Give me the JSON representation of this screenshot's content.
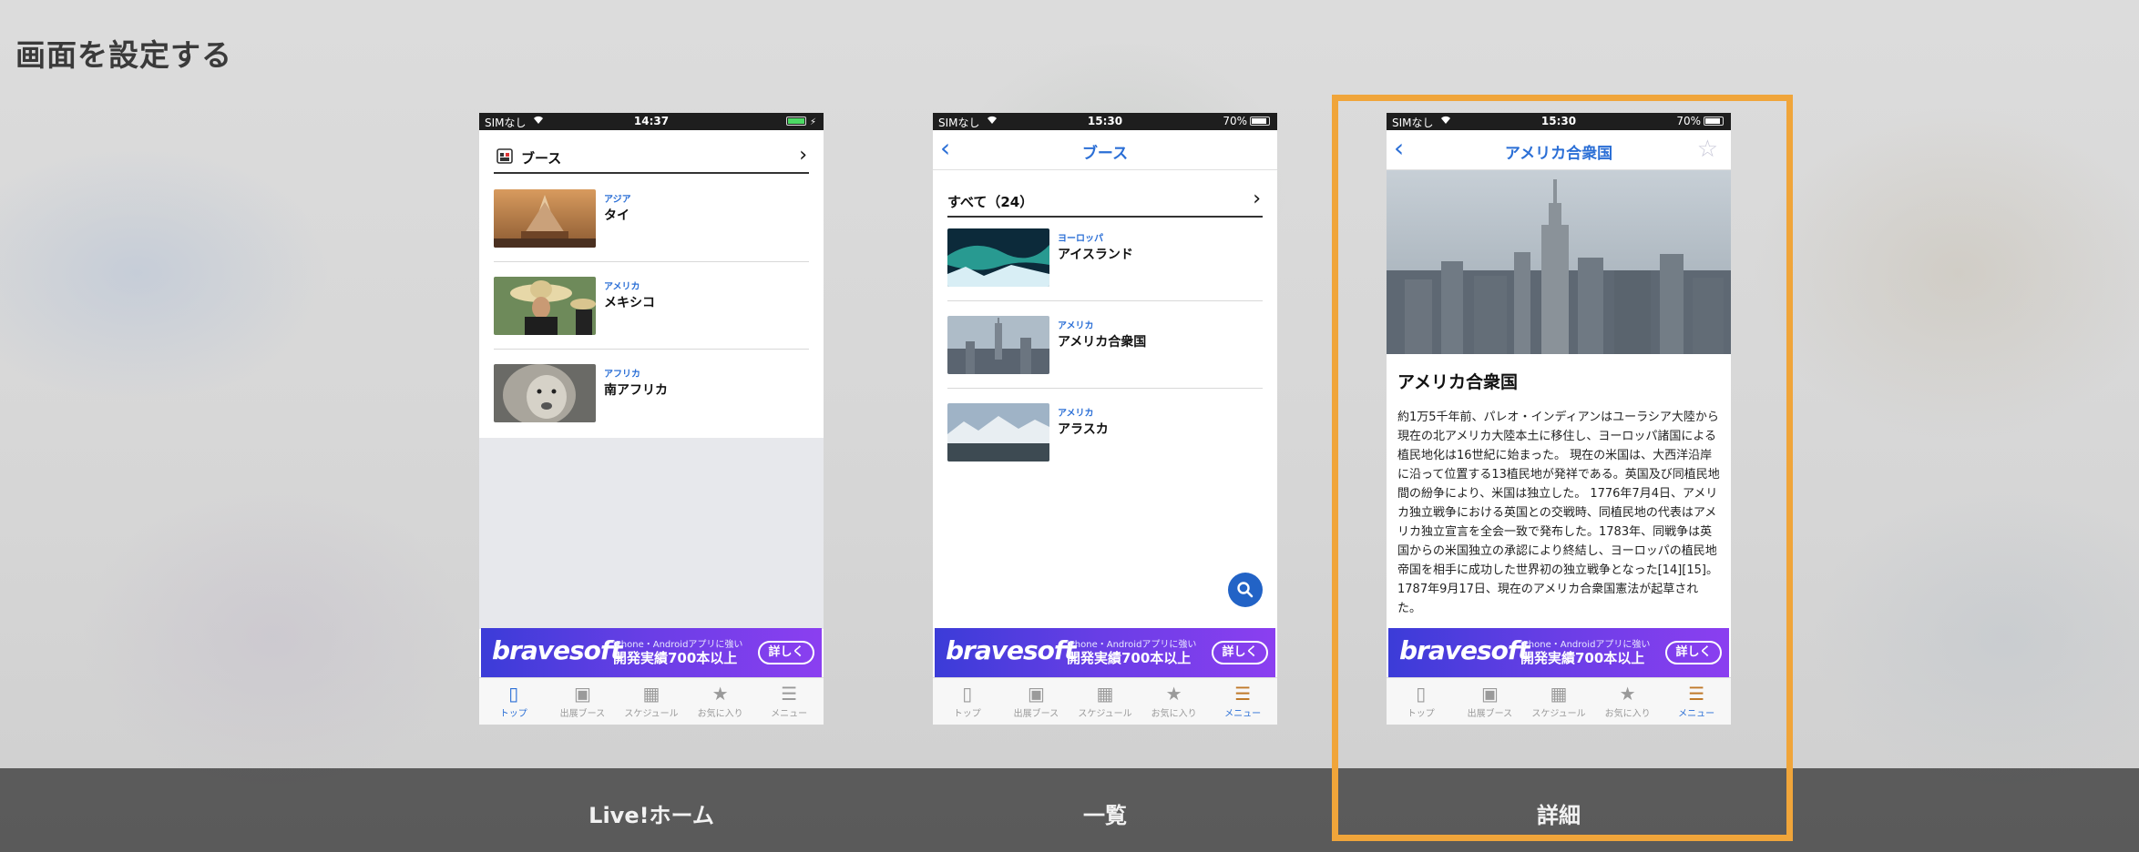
{
  "page": {
    "title": "画面を設定する"
  },
  "captions": [
    "Live!ホーム",
    "一覧",
    "詳細"
  ],
  "colors": {
    "accent": "#2b6fd6",
    "highlight": "#f0a53a",
    "ad_start": "#3b3cd8",
    "ad_end": "#8b3ff0"
  },
  "phone1": {
    "status": {
      "carrier": "SIMなし",
      "time": "14:37"
    },
    "section": {
      "label": "ブース"
    },
    "items": [
      {
        "region": "アジア",
        "name": "タイ",
        "image": "thai-temple"
      },
      {
        "region": "アメリカ",
        "name": "メキシコ",
        "image": "mariachi"
      },
      {
        "region": "アフリカ",
        "name": "南アフリカ",
        "image": "lion"
      }
    ]
  },
  "phone2": {
    "status": {
      "carrier": "SIMなし",
      "time": "15:30",
      "battery": "70%"
    },
    "nav": {
      "title": "ブース"
    },
    "section": {
      "label": "すべて（24）"
    },
    "items": [
      {
        "region": "ヨーロッパ",
        "name": "アイスランド",
        "image": "aurora"
      },
      {
        "region": "アメリカ",
        "name": "アメリカ合衆国",
        "image": "new-york"
      },
      {
        "region": "アメリカ",
        "name": "アラスカ",
        "image": "alaska"
      }
    ]
  },
  "phone3": {
    "status": {
      "carrier": "SIMなし",
      "time": "15:30",
      "battery": "70%"
    },
    "nav": {
      "title": "アメリカ合衆国"
    },
    "detail": {
      "title": "アメリカ合衆国",
      "body": "約1万5千年前、パレオ・インディアンはユーラシア大陸から現在の北アメリカ大陸本土に移住し、ヨーロッパ諸国による植民地化は16世紀に始まった。 現在の米国は、大西洋沿岸に沿って位置する13植民地が発祥である。英国及び同植民地間の紛争により、米国は独立した。 1776年7月4日、アメリカ独立戦争における英国との交戦時、同植民地の代表はアメリカ独立宣言を全会一致で発布した。1783年、同戦争は英国からの米国独立の承認により終結し、ヨーロッパの植民地帝国を相手に成功した世界初の独立戦争となった[14][15]。 1787年9月17日、現在のアメリカ合衆国憲法が起草された。"
    }
  },
  "ad": {
    "brand": "bravesoft",
    "small": "iPhone・Androidアプリに強い",
    "big": "開発実績700本以上",
    "button": "詳しく"
  },
  "tabs": [
    {
      "label": "トップ",
      "icon": "phone-icon"
    },
    {
      "label": "出展ブース",
      "icon": "booth-icon"
    },
    {
      "label": "スケジュール",
      "icon": "calendar-icon"
    },
    {
      "label": "お気に入り",
      "icon": "star-icon"
    },
    {
      "label": "メニュー",
      "icon": "menu-icon"
    }
  ]
}
